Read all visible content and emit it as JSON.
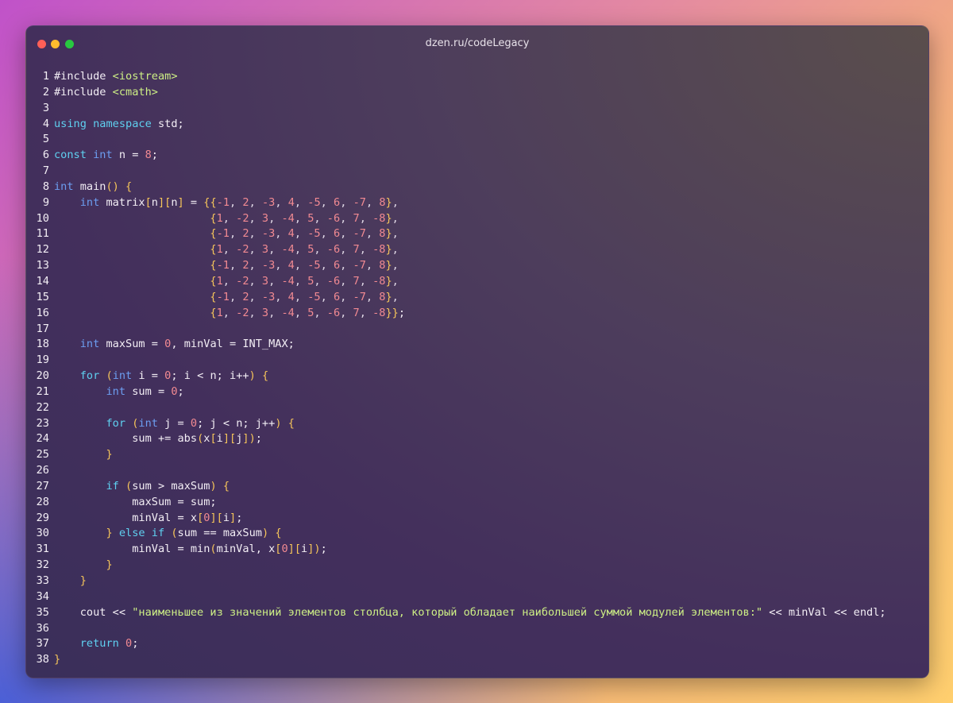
{
  "window": {
    "title": "dzen.ru/codeLegacy"
  },
  "colors": {
    "keyword": "#5fd0f0",
    "type": "#6c9df0",
    "number": "#f28a92",
    "string": "#cdef85",
    "bracket": "#f6c55a",
    "text": "#f3eef5",
    "dot_red": "#ff5f57",
    "dot_yellow": "#febc2e",
    "dot_green": "#28c840"
  },
  "lines": [
    {
      "n": "1",
      "t": [
        [
          "#include ",
          ""
        ],
        [
          "<iostream>",
          "str"
        ]
      ]
    },
    {
      "n": "2",
      "t": [
        [
          "#include ",
          ""
        ],
        [
          "<cmath>",
          "str"
        ]
      ]
    },
    {
      "n": "3",
      "t": []
    },
    {
      "n": "4",
      "t": [
        [
          "using",
          "kw"
        ],
        [
          " ",
          ""
        ],
        [
          "namespace",
          "kw"
        ],
        [
          " std;",
          ""
        ]
      ]
    },
    {
      "n": "5",
      "t": []
    },
    {
      "n": "6",
      "t": [
        [
          "const",
          "kw"
        ],
        [
          " ",
          ""
        ],
        [
          "int",
          "ty"
        ],
        [
          " n = ",
          ""
        ],
        [
          "8",
          "num"
        ],
        [
          ";",
          ""
        ]
      ]
    },
    {
      "n": "7",
      "t": []
    },
    {
      "n": "8",
      "t": [
        [
          "int",
          "ty"
        ],
        [
          " main",
          ""
        ],
        [
          "()",
          "br"
        ],
        [
          " ",
          ""
        ],
        [
          "{",
          "br"
        ]
      ]
    },
    {
      "n": "9",
      "t": [
        [
          "    ",
          ""
        ],
        [
          "int",
          "ty"
        ],
        [
          " matrix",
          ""
        ],
        [
          "[",
          "br"
        ],
        [
          "n",
          ""
        ],
        [
          "][",
          "br"
        ],
        [
          "n",
          ""
        ],
        [
          "]",
          "br"
        ],
        [
          " = ",
          ""
        ],
        [
          "{{",
          "br"
        ],
        [
          "-1",
          "num"
        ],
        [
          ", ",
          "pu"
        ],
        [
          "2",
          "num"
        ],
        [
          ", ",
          "pu"
        ],
        [
          "-3",
          "num"
        ],
        [
          ", ",
          "pu"
        ],
        [
          "4",
          "num"
        ],
        [
          ", ",
          "pu"
        ],
        [
          "-5",
          "num"
        ],
        [
          ", ",
          "pu"
        ],
        [
          "6",
          "num"
        ],
        [
          ", ",
          "pu"
        ],
        [
          "-7",
          "num"
        ],
        [
          ", ",
          "pu"
        ],
        [
          "8",
          "num"
        ],
        [
          "}",
          "br"
        ],
        [
          ",",
          "pu"
        ]
      ]
    },
    {
      "n": "10",
      "t": [
        [
          "                        ",
          ""
        ],
        [
          "{",
          "br"
        ],
        [
          "1",
          "num"
        ],
        [
          ", ",
          "pu"
        ],
        [
          "-2",
          "num"
        ],
        [
          ", ",
          "pu"
        ],
        [
          "3",
          "num"
        ],
        [
          ", ",
          "pu"
        ],
        [
          "-4",
          "num"
        ],
        [
          ", ",
          "pu"
        ],
        [
          "5",
          "num"
        ],
        [
          ", ",
          "pu"
        ],
        [
          "-6",
          "num"
        ],
        [
          ", ",
          "pu"
        ],
        [
          "7",
          "num"
        ],
        [
          ", ",
          "pu"
        ],
        [
          "-8",
          "num"
        ],
        [
          "}",
          "br"
        ],
        [
          ",",
          "pu"
        ]
      ]
    },
    {
      "n": "11",
      "t": [
        [
          "                        ",
          ""
        ],
        [
          "{",
          "br"
        ],
        [
          "-1",
          "num"
        ],
        [
          ", ",
          "pu"
        ],
        [
          "2",
          "num"
        ],
        [
          ", ",
          "pu"
        ],
        [
          "-3",
          "num"
        ],
        [
          ", ",
          "pu"
        ],
        [
          "4",
          "num"
        ],
        [
          ", ",
          "pu"
        ],
        [
          "-5",
          "num"
        ],
        [
          ", ",
          "pu"
        ],
        [
          "6",
          "num"
        ],
        [
          ", ",
          "pu"
        ],
        [
          "-7",
          "num"
        ],
        [
          ", ",
          "pu"
        ],
        [
          "8",
          "num"
        ],
        [
          "}",
          "br"
        ],
        [
          ",",
          "pu"
        ]
      ]
    },
    {
      "n": "12",
      "t": [
        [
          "                        ",
          ""
        ],
        [
          "{",
          "br"
        ],
        [
          "1",
          "num"
        ],
        [
          ", ",
          "pu"
        ],
        [
          "-2",
          "num"
        ],
        [
          ", ",
          "pu"
        ],
        [
          "3",
          "num"
        ],
        [
          ", ",
          "pu"
        ],
        [
          "-4",
          "num"
        ],
        [
          ", ",
          "pu"
        ],
        [
          "5",
          "num"
        ],
        [
          ", ",
          "pu"
        ],
        [
          "-6",
          "num"
        ],
        [
          ", ",
          "pu"
        ],
        [
          "7",
          "num"
        ],
        [
          ", ",
          "pu"
        ],
        [
          "-8",
          "num"
        ],
        [
          "}",
          "br"
        ],
        [
          ",",
          "pu"
        ]
      ]
    },
    {
      "n": "13",
      "t": [
        [
          "                        ",
          ""
        ],
        [
          "{",
          "br"
        ],
        [
          "-1",
          "num"
        ],
        [
          ", ",
          "pu"
        ],
        [
          "2",
          "num"
        ],
        [
          ", ",
          "pu"
        ],
        [
          "-3",
          "num"
        ],
        [
          ", ",
          "pu"
        ],
        [
          "4",
          "num"
        ],
        [
          ", ",
          "pu"
        ],
        [
          "-5",
          "num"
        ],
        [
          ", ",
          "pu"
        ],
        [
          "6",
          "num"
        ],
        [
          ", ",
          "pu"
        ],
        [
          "-7",
          "num"
        ],
        [
          ", ",
          "pu"
        ],
        [
          "8",
          "num"
        ],
        [
          "}",
          "br"
        ],
        [
          ",",
          "pu"
        ]
      ]
    },
    {
      "n": "14",
      "t": [
        [
          "                        ",
          ""
        ],
        [
          "{",
          "br"
        ],
        [
          "1",
          "num"
        ],
        [
          ", ",
          "pu"
        ],
        [
          "-2",
          "num"
        ],
        [
          ", ",
          "pu"
        ],
        [
          "3",
          "num"
        ],
        [
          ", ",
          "pu"
        ],
        [
          "-4",
          "num"
        ],
        [
          ", ",
          "pu"
        ],
        [
          "5",
          "num"
        ],
        [
          ", ",
          "pu"
        ],
        [
          "-6",
          "num"
        ],
        [
          ", ",
          "pu"
        ],
        [
          "7",
          "num"
        ],
        [
          ", ",
          "pu"
        ],
        [
          "-8",
          "num"
        ],
        [
          "}",
          "br"
        ],
        [
          ",",
          "pu"
        ]
      ]
    },
    {
      "n": "15",
      "t": [
        [
          "                        ",
          ""
        ],
        [
          "{",
          "br"
        ],
        [
          "-1",
          "num"
        ],
        [
          ", ",
          "pu"
        ],
        [
          "2",
          "num"
        ],
        [
          ", ",
          "pu"
        ],
        [
          "-3",
          "num"
        ],
        [
          ", ",
          "pu"
        ],
        [
          "4",
          "num"
        ],
        [
          ", ",
          "pu"
        ],
        [
          "-5",
          "num"
        ],
        [
          ", ",
          "pu"
        ],
        [
          "6",
          "num"
        ],
        [
          ", ",
          "pu"
        ],
        [
          "-7",
          "num"
        ],
        [
          ", ",
          "pu"
        ],
        [
          "8",
          "num"
        ],
        [
          "}",
          "br"
        ],
        [
          ",",
          "pu"
        ]
      ]
    },
    {
      "n": "16",
      "t": [
        [
          "                        ",
          ""
        ],
        [
          "{",
          "br"
        ],
        [
          "1",
          "num"
        ],
        [
          ", ",
          "pu"
        ],
        [
          "-2",
          "num"
        ],
        [
          ", ",
          "pu"
        ],
        [
          "3",
          "num"
        ],
        [
          ", ",
          "pu"
        ],
        [
          "-4",
          "num"
        ],
        [
          ", ",
          "pu"
        ],
        [
          "5",
          "num"
        ],
        [
          ", ",
          "pu"
        ],
        [
          "-6",
          "num"
        ],
        [
          ", ",
          "pu"
        ],
        [
          "7",
          "num"
        ],
        [
          ", ",
          "pu"
        ],
        [
          "-8",
          "num"
        ],
        [
          "}}",
          "br"
        ],
        [
          ";",
          ""
        ]
      ]
    },
    {
      "n": "17",
      "t": []
    },
    {
      "n": "18",
      "t": [
        [
          "    ",
          ""
        ],
        [
          "int",
          "ty"
        ],
        [
          " maxSum = ",
          ""
        ],
        [
          "0",
          "num"
        ],
        [
          ", minVal = INT_MAX;",
          ""
        ]
      ]
    },
    {
      "n": "19",
      "t": []
    },
    {
      "n": "20",
      "t": [
        [
          "    ",
          ""
        ],
        [
          "for",
          "kw"
        ],
        [
          " ",
          ""
        ],
        [
          "(",
          "br"
        ],
        [
          "int",
          "ty"
        ],
        [
          " i = ",
          ""
        ],
        [
          "0",
          "num"
        ],
        [
          "; i < n; i++",
          ""
        ],
        [
          ")",
          "br"
        ],
        [
          " ",
          ""
        ],
        [
          "{",
          "br"
        ]
      ]
    },
    {
      "n": "21",
      "t": [
        [
          "        ",
          ""
        ],
        [
          "int",
          "ty"
        ],
        [
          " sum = ",
          ""
        ],
        [
          "0",
          "num"
        ],
        [
          ";",
          ""
        ]
      ]
    },
    {
      "n": "22",
      "t": []
    },
    {
      "n": "23",
      "t": [
        [
          "        ",
          ""
        ],
        [
          "for",
          "kw"
        ],
        [
          " ",
          ""
        ],
        [
          "(",
          "br"
        ],
        [
          "int",
          "ty"
        ],
        [
          " j = ",
          ""
        ],
        [
          "0",
          "num"
        ],
        [
          "; j < n; j++",
          ""
        ],
        [
          ")",
          "br"
        ],
        [
          " ",
          ""
        ],
        [
          "{",
          "br"
        ]
      ]
    },
    {
      "n": "24",
      "t": [
        [
          "            sum += abs",
          ""
        ],
        [
          "(",
          "br"
        ],
        [
          "x",
          ""
        ],
        [
          "[",
          "br"
        ],
        [
          "i",
          ""
        ],
        [
          "][",
          "br"
        ],
        [
          "j",
          ""
        ],
        [
          "]",
          "br"
        ],
        [
          ")",
          "br"
        ],
        [
          ";",
          ""
        ]
      ]
    },
    {
      "n": "25",
      "t": [
        [
          "        ",
          ""
        ],
        [
          "}",
          "br"
        ]
      ]
    },
    {
      "n": "26",
      "t": []
    },
    {
      "n": "27",
      "t": [
        [
          "        ",
          ""
        ],
        [
          "if",
          "kw"
        ],
        [
          " ",
          ""
        ],
        [
          "(",
          "br"
        ],
        [
          "sum > maxSum",
          ""
        ],
        [
          ")",
          "br"
        ],
        [
          " ",
          ""
        ],
        [
          "{",
          "br"
        ]
      ]
    },
    {
      "n": "28",
      "t": [
        [
          "            maxSum = sum;",
          ""
        ]
      ]
    },
    {
      "n": "29",
      "t": [
        [
          "            minVal = x",
          ""
        ],
        [
          "[",
          "br"
        ],
        [
          "0",
          "num"
        ],
        [
          "][",
          "br"
        ],
        [
          "i",
          ""
        ],
        [
          "]",
          "br"
        ],
        [
          ";",
          ""
        ]
      ]
    },
    {
      "n": "30",
      "t": [
        [
          "        ",
          ""
        ],
        [
          "}",
          "br"
        ],
        [
          " ",
          ""
        ],
        [
          "else",
          "kw"
        ],
        [
          " ",
          ""
        ],
        [
          "if",
          "kw"
        ],
        [
          " ",
          ""
        ],
        [
          "(",
          "br"
        ],
        [
          "sum == maxSum",
          ""
        ],
        [
          ")",
          "br"
        ],
        [
          " ",
          ""
        ],
        [
          "{",
          "br"
        ]
      ]
    },
    {
      "n": "31",
      "t": [
        [
          "            minVal = min",
          ""
        ],
        [
          "(",
          "br"
        ],
        [
          "minVal, x",
          ""
        ],
        [
          "[",
          "br"
        ],
        [
          "0",
          "num"
        ],
        [
          "][",
          "br"
        ],
        [
          "i",
          ""
        ],
        [
          "]",
          "br"
        ],
        [
          ")",
          "br"
        ],
        [
          ";",
          ""
        ]
      ]
    },
    {
      "n": "32",
      "t": [
        [
          "        ",
          ""
        ],
        [
          "}",
          "br"
        ]
      ]
    },
    {
      "n": "33",
      "t": [
        [
          "    ",
          ""
        ],
        [
          "}",
          "br"
        ]
      ]
    },
    {
      "n": "34",
      "t": []
    },
    {
      "n": "35",
      "t": [
        [
          "    cout << ",
          ""
        ],
        [
          "\"наименьшее из значений элементов столбца, который обладает наибольшей суммой модулей элементов:\"",
          "str"
        ],
        [
          " << minVal << endl;",
          ""
        ]
      ]
    },
    {
      "n": "36",
      "t": []
    },
    {
      "n": "37",
      "t": [
        [
          "    ",
          ""
        ],
        [
          "return",
          "kw"
        ],
        [
          " ",
          ""
        ],
        [
          "0",
          "num"
        ],
        [
          ";",
          ""
        ]
      ]
    },
    {
      "n": "38",
      "t": [
        [
          "}",
          "br"
        ]
      ]
    }
  ]
}
